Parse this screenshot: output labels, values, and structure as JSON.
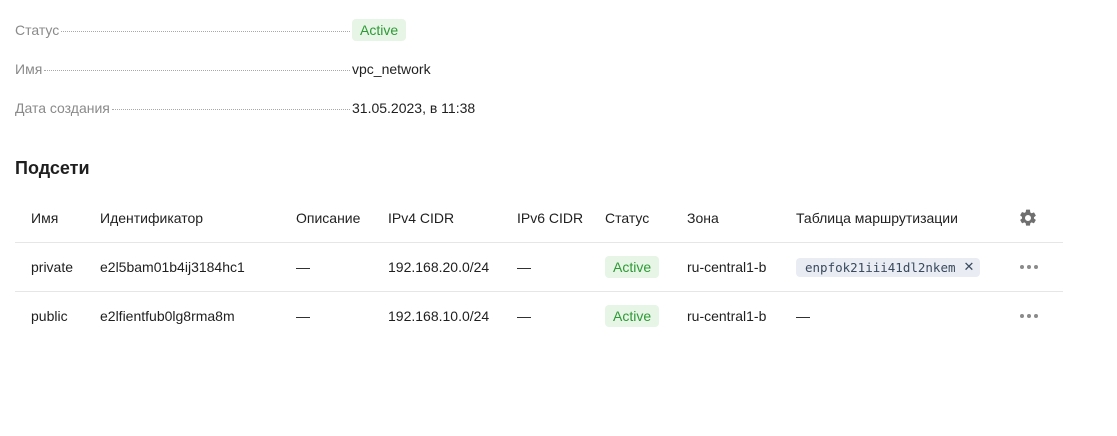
{
  "details": {
    "status_label": "Статус",
    "status_value": "Active",
    "name_label": "Имя",
    "name_value": "vpc_network",
    "created_label": "Дата создания",
    "created_value": "31.05.2023, в 11:38"
  },
  "subnets": {
    "title": "Подсети",
    "columns": {
      "name": "Имя",
      "id": "Идентификатор",
      "description": "Описание",
      "ipv4": "IPv4 CIDR",
      "ipv6": "IPv6 CIDR",
      "status": "Статус",
      "zone": "Зона",
      "route_table": "Таблица маршрутизации"
    },
    "settings_icon": "gear-icon",
    "rows": [
      {
        "name": "private",
        "id": "e2l5bam01b4ij3184hc1",
        "description": "—",
        "ipv4": "192.168.20.0/24",
        "ipv6": "—",
        "status": "Active",
        "zone": "ru-central1-b",
        "route_table": "enpfok21iii41dl2nkem"
      },
      {
        "name": "public",
        "id": "e2lfientfub0lg8rma8m",
        "description": "—",
        "ipv4": "192.168.10.0/24",
        "ipv6": "—",
        "status": "Active",
        "zone": "ru-central1-b",
        "route_table": "—"
      }
    ]
  },
  "colors": {
    "status_bg": "#e6f5e6",
    "status_text": "#2e9a35",
    "chip_bg": "#e9edf3"
  }
}
